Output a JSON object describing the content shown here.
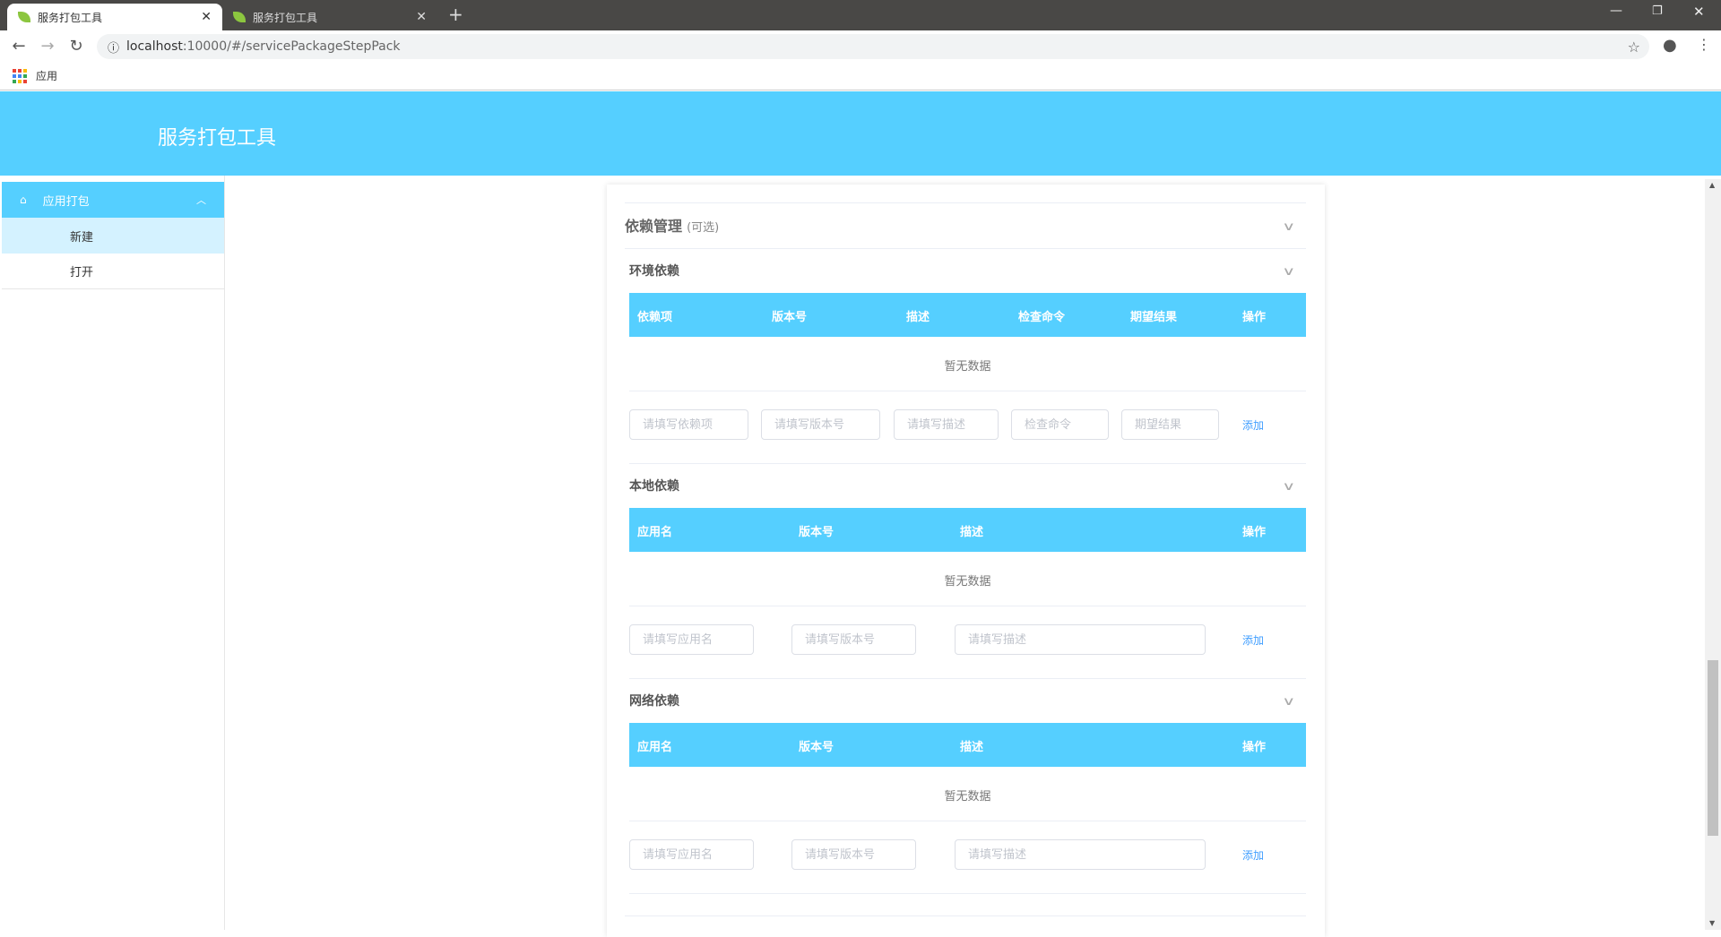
{
  "browser": {
    "tabs": [
      {
        "title": "服务打包工具"
      },
      {
        "title": "服务打包工具"
      }
    ],
    "url_host": "localhost",
    "url_rest": ":10000/#/servicePackageStepPack",
    "bookmark_apps": "应用"
  },
  "app": {
    "title": "服务打包工具"
  },
  "sidebar": {
    "group": "应用打包",
    "items": [
      {
        "label": "新建"
      },
      {
        "label": "打开"
      }
    ]
  },
  "main": {
    "section_title": "依赖管理",
    "section_hint": "(可选)",
    "env": {
      "title": "环境依赖",
      "columns": [
        "依赖项",
        "版本号",
        "描述",
        "检查命令",
        "期望结果",
        "操作"
      ],
      "empty": "暂无数据",
      "placeholders": [
        "请填写依赖项",
        "请填写版本号",
        "请填写描述",
        "检查命令",
        "期望结果"
      ],
      "add": "添加"
    },
    "local": {
      "title": "本地依赖",
      "columns": [
        "应用名",
        "版本号",
        "描述",
        "操作"
      ],
      "empty": "暂无数据",
      "placeholders": [
        "请填写应用名",
        "请填写版本号",
        "请填写描述"
      ],
      "add": "添加"
    },
    "network": {
      "title": "网络依赖",
      "columns": [
        "应用名",
        "版本号",
        "描述",
        "操作"
      ],
      "empty": "暂无数据",
      "placeholders": [
        "请填写应用名",
        "请填写版本号",
        "请填写描述"
      ],
      "add": "添加"
    }
  },
  "colors": {
    "accent": "#55cfff",
    "link": "#409eff"
  }
}
